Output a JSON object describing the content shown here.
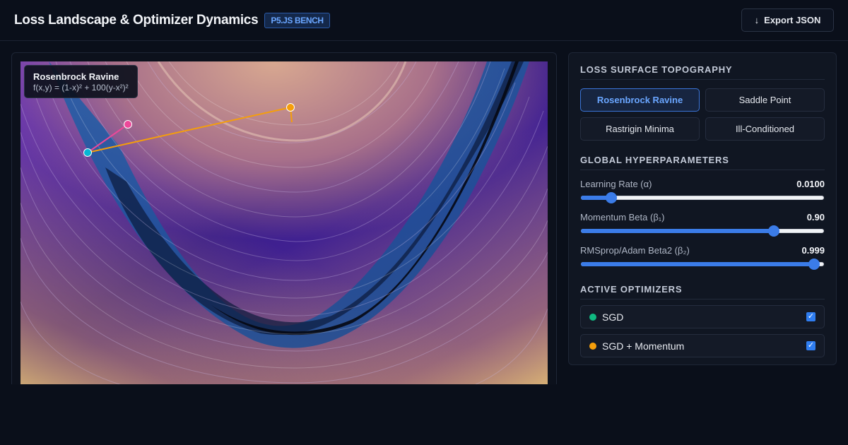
{
  "header": {
    "title": "Loss Landscape & Optimizer Dynamics",
    "badge": "P5.JS BENCH",
    "export_icon": "↓",
    "export_label": "Export JSON"
  },
  "canvas": {
    "surface_name": "Rosenbrock Ravine",
    "surface_formula": "f(x,y) = (1-x)² + 100(y-x²)²"
  },
  "panel": {
    "topography": {
      "title": "LOSS SURFACE TOPOGRAPHY",
      "options": [
        "Rosenbrock Ravine",
        "Saddle Point",
        "Rastrigin Minima",
        "Ill-Conditioned"
      ],
      "selected": "Rosenbrock Ravine"
    },
    "hyperparameters": {
      "title": "GLOBAL HYPERPARAMETERS",
      "items": [
        {
          "label": "Learning Rate (α)",
          "value": "0.0100",
          "fraction": 0.11
        },
        {
          "label": "Momentum Beta (β₁)",
          "value": "0.90",
          "fraction": 0.805
        },
        {
          "label": "RMSprop/Adam Beta2 (β₂)",
          "value": "0.999",
          "fraction": 0.98
        }
      ]
    },
    "optimizers": {
      "title": "ACTIVE OPTIMIZERS",
      "items": [
        {
          "name": "SGD",
          "color": "#10b981",
          "checked": true
        },
        {
          "name": "SGD + Momentum",
          "color": "#f59e0b",
          "checked": true
        }
      ]
    }
  },
  "colors": {
    "accent": "#3b7ce8",
    "path_orange": "#f59e0b",
    "path_pink": "#ec4899",
    "path_cyan": "#06b6d4"
  },
  "icons": {
    "export": "download-icon",
    "check": "check-icon"
  }
}
